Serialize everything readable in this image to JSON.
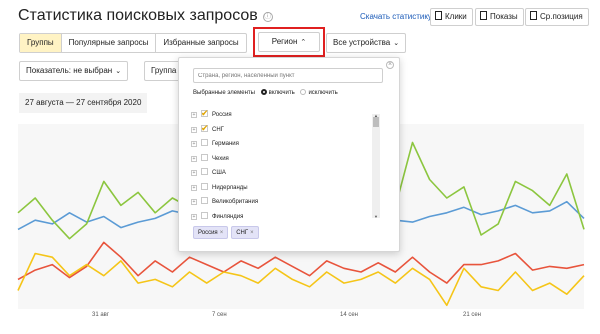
{
  "header": {
    "title": "Статистика поисковых запросов",
    "info_icon": "ⓘ",
    "stat_link": "Скачать статистику",
    "buttons": [
      {
        "label": "Клики",
        "icon": "document-icon"
      },
      {
        "label": "Показы",
        "icon": "document-icon"
      },
      {
        "label": "Ср.позиция",
        "icon": "document-icon"
      }
    ]
  },
  "tabs": [
    {
      "label": "Группы",
      "active": true
    },
    {
      "label": "Популярные запросы",
      "active": false
    },
    {
      "label": "Избранные запросы",
      "active": false
    }
  ],
  "filters": {
    "region_label": "Регион",
    "devices_label": "Все устройства",
    "indicator_label": "Показатель: не выбран",
    "group_label": "Группа",
    "date_range": "27 августа — 27 сентября 2020"
  },
  "region_popup": {
    "search_placeholder": "Страна, регион, населенный пункт",
    "mode_label": "Выбранные элементы",
    "mode_include": "включить",
    "mode_exclude": "исключить",
    "mode_selected": "include",
    "close_icon": "×",
    "items": [
      {
        "label": "Россия",
        "checked": true
      },
      {
        "label": "СНГ",
        "checked": true
      },
      {
        "label": "Германия",
        "checked": false
      },
      {
        "label": "Чехия",
        "checked": false
      },
      {
        "label": "США",
        "checked": false
      },
      {
        "label": "Нидерланды",
        "checked": false
      },
      {
        "label": "Великобритания",
        "checked": false
      },
      {
        "label": "Финляндия",
        "checked": false
      }
    ],
    "chips": [
      {
        "label": "Россия"
      },
      {
        "label": "СНГ"
      }
    ]
  },
  "chart_data": {
    "type": "line",
    "x_ticks": [
      "31 авг",
      "7 сен",
      "14 сен",
      "21 сен"
    ],
    "colors": {
      "blue": "#5b9bd5",
      "green": "#8cc63f",
      "red": "#e8543c",
      "yellow": "#f5c518",
      "background": "#f7f7f7"
    },
    "series": [
      {
        "color": "blue",
        "values": [
          0.43,
          0.48,
          0.46,
          0.52,
          0.47,
          0.5,
          0.44,
          0.47,
          0.49,
          0.53,
          0.51,
          0.48,
          0.47,
          0.46,
          0.53,
          0.51,
          0.49,
          0.53,
          0.52,
          0.5,
          0.49,
          0.5,
          0.48,
          0.47,
          0.5,
          0.52,
          0.55,
          0.51,
          0.53,
          0.56,
          0.52,
          0.53,
          0.58,
          0.49
        ]
      },
      {
        "color": "green",
        "values": [
          0.52,
          0.6,
          0.48,
          0.38,
          0.46,
          0.69,
          0.56,
          0.63,
          0.52,
          0.6,
          0.55,
          0.49,
          0.58,
          0.45,
          0.52,
          0.6,
          0.55,
          0.5,
          0.47,
          0.58,
          0.62,
          0.55,
          0.55,
          0.9,
          0.7,
          0.6,
          0.66,
          0.4,
          0.46,
          0.69,
          0.64,
          0.56,
          0.73,
          0.43
        ]
      },
      {
        "color": "red",
        "values": [
          0.16,
          0.21,
          0.24,
          0.17,
          0.23,
          0.36,
          0.28,
          0.18,
          0.26,
          0.2,
          0.28,
          0.24,
          0.2,
          0.26,
          0.22,
          0.28,
          0.23,
          0.18,
          0.26,
          0.22,
          0.2,
          0.25,
          0.2,
          0.28,
          0.2,
          0.14,
          0.24,
          0.24,
          0.26,
          0.3,
          0.21,
          0.23,
          0.22,
          0.24
        ]
      },
      {
        "color": "yellow",
        "values": [
          0.1,
          0.3,
          0.28,
          0.18,
          0.24,
          0.18,
          0.26,
          0.14,
          0.16,
          0.12,
          0.2,
          0.14,
          0.2,
          0.18,
          0.14,
          0.22,
          0.16,
          0.12,
          0.2,
          0.14,
          0.16,
          0.2,
          0.14,
          0.22,
          0.16,
          0.02,
          0.22,
          0.12,
          0.1,
          0.2,
          0.1,
          0.14,
          0.08,
          0.18
        ]
      }
    ]
  }
}
